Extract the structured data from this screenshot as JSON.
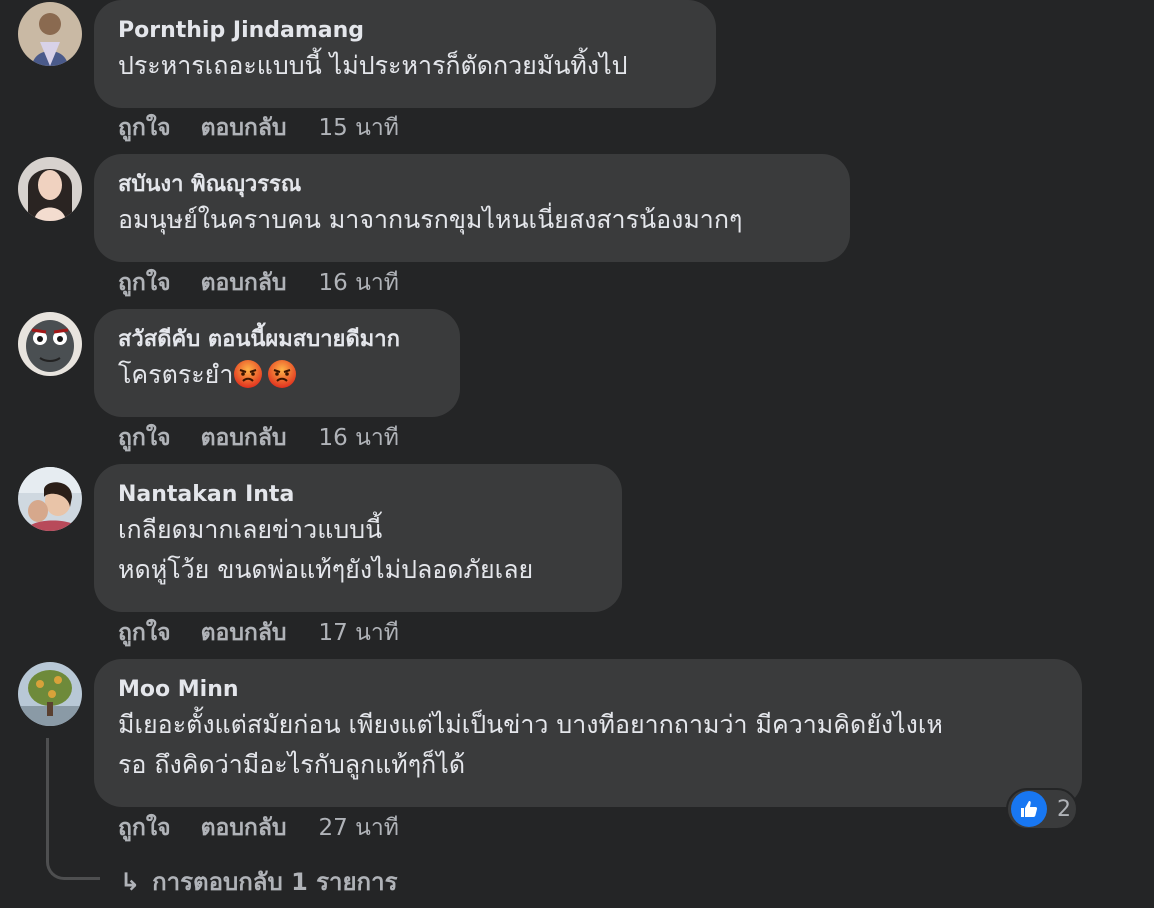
{
  "comments": [
    {
      "author": "Pornthip Jindamang",
      "lines": [
        "ประหารเถอะแบบนี้ ไม่ประหารก็ตัดกวยมันทิ้งไป"
      ],
      "like_label": "ถูกใจ",
      "reply_label": "ตอบกลับ",
      "time": "15 นาที"
    },
    {
      "author": "สบันงา พิณญุวรรณ",
      "lines": [
        "อมนุษย์ในคราบคน มาจากนรกขุมไหนเนี่ยสงสารน้องมากๆ"
      ],
      "like_label": "ถูกใจ",
      "reply_label": "ตอบกลับ",
      "time": "16 นาที"
    },
    {
      "author": "สวัสดีคับ ตอนนี้ผมสบายดีมาก",
      "lines": [
        "โครตระยำ"
      ],
      "emojis": [
        "angry-face",
        "angry-face"
      ],
      "like_label": "ถูกใจ",
      "reply_label": "ตอบกลับ",
      "time": "16 นาที"
    },
    {
      "author": "Nantakan Inta",
      "lines": [
        "เกลียดมากเลยข่าวแบบนี้",
        "หดหู่โว้ย ขนดพ่อแท้ๆยังไม่ปลอดภัยเลย"
      ],
      "like_label": "ถูกใจ",
      "reply_label": "ตอบกลับ",
      "time": "17 นาที"
    },
    {
      "author": "Moo Minn",
      "lines": [
        "มีเยอะตั้งแต่สมัยก่อน เพียงแต่ไม่เป็นข่าว บางทีอยากถามว่า มีความคิดยังไงเห",
        "รอ ถึงคิดว่ามีอะไรกับลูกแท้ๆก็ได้"
      ],
      "like_label": "ถูกใจ",
      "reply_label": "ตอบกลับ",
      "time": "27 นาที",
      "reaction": {
        "icon": "like-icon",
        "count": "2"
      }
    }
  ],
  "replies_link": "การตอบกลับ 1 รายการ",
  "colors": {
    "background": "#242526",
    "bubble": "#3a3b3c",
    "text": "#e4e6eb",
    "secondary": "#b0b3b8",
    "like_blue": "#1877f2"
  }
}
